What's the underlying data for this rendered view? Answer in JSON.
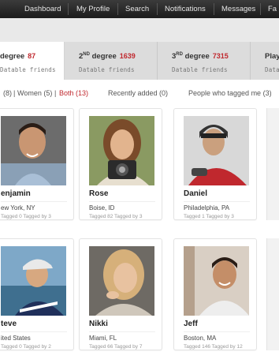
{
  "topnav": {
    "items": [
      "Dashboard",
      "My Profile",
      "Search",
      "Notifications",
      "Messages",
      "Fa"
    ]
  },
  "tabs": [
    {
      "title": "degree",
      "count": "87",
      "sub": "Datable friends"
    },
    {
      "title_num": "2",
      "title_sup": "ND",
      "title_word": "degree",
      "count": "1639",
      "sub": "Datable friends"
    },
    {
      "title_num": "3",
      "title_sup": "RD",
      "title_word": "degree",
      "count": "7315",
      "sub": "Datable friends"
    },
    {
      "title": "Play",
      "sub": "Datable"
    }
  ],
  "filters": {
    "men": "(8)",
    "sep1": "|",
    "women": "Women (5)",
    "sep2": "|",
    "both": "Both (13)",
    "recent": "Recently added (0)",
    "tagged_me": "People who tagged me (3)"
  },
  "people": [
    {
      "name": "enjamin",
      "location": "ew York, NY",
      "stats": "Tagged 0   Tagged by 3"
    },
    {
      "name": "Rose",
      "location": "Boise, ID",
      "stats": "Tagged 82   Tagged by 3"
    },
    {
      "name": "Daniel",
      "location": "Philadelphia, PA",
      "stats": "Tagged 1   Tagged by 3"
    },
    {
      "name": "teve",
      "location": "ited States",
      "stats": "Tagged 0   Tagged by 2"
    },
    {
      "name": "Nikki",
      "location": "Miami, FL",
      "stats": "Tagged 66   Tagged by 7"
    },
    {
      "name": "Jeff",
      "location": "Boston, MA",
      "stats": "Tagged 146   Tagged by 12"
    }
  ],
  "colors": {
    "accent": "#c0282e",
    "nav_bg": "#262626"
  }
}
